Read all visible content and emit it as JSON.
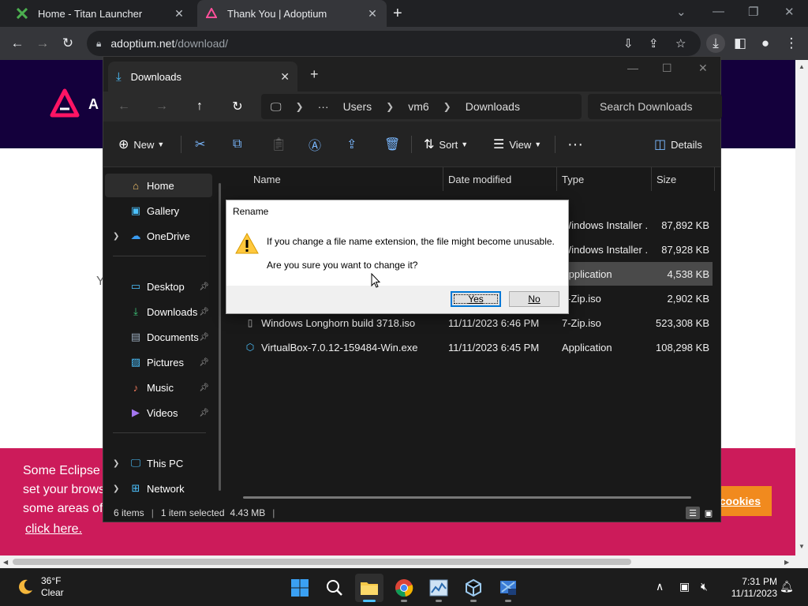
{
  "browser": {
    "tabs": [
      {
        "title": "Home - Titan Launcher",
        "active": false
      },
      {
        "title": "Thank You | Adoptium",
        "active": true
      }
    ],
    "url_host": "adoptium.net",
    "url_path": "/download/"
  },
  "webpage": {
    "brand_letter": "A",
    "stray_text": "Y",
    "cookie_lines": [
      "Some Eclipse",
      "set your brows",
      "some areas of"
    ],
    "cookie_link": "click here.",
    "cookie_button": "cookies"
  },
  "explorer": {
    "tab_title": "Downloads",
    "breadcrumb": [
      "Users",
      "vm6",
      "Downloads"
    ],
    "search_placeholder": "Search Downloads",
    "commands": {
      "new": "New",
      "sort": "Sort",
      "view": "View",
      "details": "Details"
    },
    "sidebar": [
      {
        "label": "Home",
        "icon": "home-icon"
      },
      {
        "label": "Gallery",
        "icon": "gallery-icon"
      },
      {
        "label": "OneDrive",
        "icon": "cloud-icon"
      },
      {
        "label": "Desktop",
        "icon": "desktop-icon"
      },
      {
        "label": "Downloads",
        "icon": "download-icon"
      },
      {
        "label": "Documents",
        "icon": "documents-icon"
      },
      {
        "label": "Pictures",
        "icon": "pictures-icon"
      },
      {
        "label": "Music",
        "icon": "music-icon"
      },
      {
        "label": "Videos",
        "icon": "videos-icon"
      },
      {
        "label": "This PC",
        "icon": "pc-icon"
      },
      {
        "label": "Network",
        "icon": "network-icon"
      }
    ],
    "columns": [
      "Name",
      "Date modified",
      "Type",
      "Size"
    ],
    "files": [
      {
        "name": "",
        "date": "",
        "type": "Windows Installer ...",
        "size": "87,892 KB"
      },
      {
        "name": "",
        "date": "",
        "type": "Windows Installer ...",
        "size": "87,928 KB"
      },
      {
        "name": "",
        "date": "",
        "type": "Application",
        "size": "4,538 KB",
        "selected": true
      },
      {
        "name": "",
        "date": "",
        "type": "7-Zip.iso",
        "size": "2,902 KB"
      },
      {
        "name": "Windows Longhorn build 3718.iso",
        "date": "11/11/2023 6:46 PM",
        "type": "7-Zip.iso",
        "size": "523,308 KB"
      },
      {
        "name": "VirtualBox-7.0.12-159484-Win.exe",
        "date": "11/11/2023 6:45 PM",
        "type": "Application",
        "size": "108,298 KB"
      }
    ],
    "status": {
      "count": "6 items",
      "selection": "1 item selected",
      "size": "4.43 MB"
    }
  },
  "dialog": {
    "title": "Rename",
    "message1": "If you change a file name extension, the file might become unusable.",
    "message2": "Are you sure you want to change it?",
    "yes": "Yes",
    "no": "No"
  },
  "taskbar": {
    "temperature": "36°F",
    "condition": "Clear",
    "time": "7:31 PM",
    "date": "11/11/2023"
  }
}
